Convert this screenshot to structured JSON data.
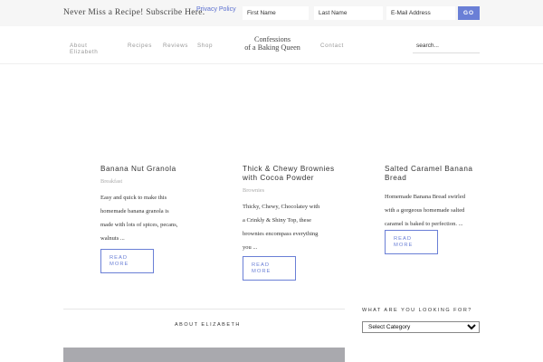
{
  "subscribe": {
    "text": "Never Miss a Recipe! Subscribe Here.",
    "privacy_label": "Privacy Policy",
    "first_name_placeholder": "First Name",
    "last_name_placeholder": "Last Name",
    "email_placeholder": "E-Mail Address",
    "go_label": "GO"
  },
  "nav": {
    "about_line1": "About",
    "about_line2": "Elizabeth",
    "recipes": "Recipes",
    "reviews": "Reviews",
    "shop": "Shop",
    "contact": "Contact"
  },
  "logo": {
    "line1": "Confessions",
    "line2": "of a Baking Queen"
  },
  "search": {
    "placeholder": "search..."
  },
  "posts": [
    {
      "title_lines": [
        "Banana Nut Granola"
      ],
      "category": "Breakfast",
      "excerpt_lines": [
        "Easy and quick to make this",
        "homemade banana granola is",
        "made with lots of spices, pecans,",
        "walnuts ..."
      ],
      "read_more_line1": "READ",
      "read_more_line2": "MORE"
    },
    {
      "title_lines": [
        "Thick & Chewy Brownies",
        "with Cocoa Powder"
      ],
      "category": "Brownies",
      "excerpt_lines": [
        "Thicky, Chewy, Chocolatey with",
        "a Crinkly & Shiny Top, these",
        "brownies encompass everything",
        "you ..."
      ],
      "read_more_line1": "READ",
      "read_more_line2": "MORE"
    },
    {
      "title_lines": [
        "Salted Caramel Banana",
        "Bread"
      ],
      "category": "",
      "excerpt_lines": [
        "Homemade Banana Bread swirled",
        "with a gorgeous homemade salted",
        "caramel is baked to perfection. ..."
      ],
      "read_more_line1": "READ",
      "read_more_line2": "MORE"
    }
  ],
  "about_heading": "ABOUT ELIZABETH",
  "sidebar": {
    "heading": "WHAT ARE YOU LOOKING FOR?",
    "select_value": "Select Category"
  },
  "colors": {
    "accent": "#6a7fd6",
    "panel_gray": "#a9a9ae"
  }
}
